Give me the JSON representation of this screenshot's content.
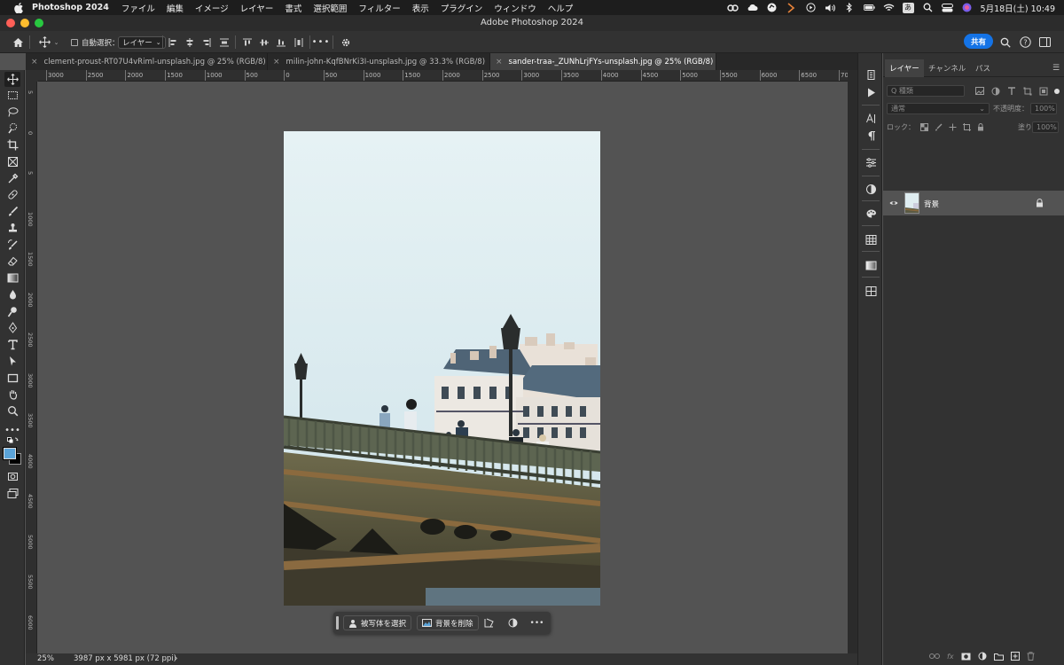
{
  "menubar": {
    "app_name": "Photoshop 2024",
    "items": [
      "ファイル",
      "編集",
      "イメージ",
      "レイヤー",
      "書式",
      "選択範囲",
      "フィルター",
      "表示",
      "プラグイン",
      "ウィンドウ",
      "ヘルプ"
    ],
    "ime_label": "あ",
    "clock": "5月18日(土)  10:49"
  },
  "window": {
    "title": "Adobe Photoshop 2024"
  },
  "options_bar": {
    "auto_select_label": "自動選択：",
    "auto_select_target": "レイヤー",
    "share_label": "共有"
  },
  "tabs": [
    {
      "label": "clement-proust-RT07U4vRiml-unsplash.jpg @ 25% (RGB/8)",
      "active": false
    },
    {
      "label": "milin-john-KqfBNrKi3I-unsplash.jpg @ 33.3% (RGB/8)",
      "active": false
    },
    {
      "label": "sander-traa-_ZUNhLrjFYs-unsplash.jpg @ 25% (RGB/8)",
      "active": true
    }
  ],
  "ruler": {
    "h_labels": [
      "3000",
      "2500",
      "2000",
      "1500",
      "1000",
      "500",
      "0",
      "500",
      "1000",
      "1500",
      "2000",
      "2500",
      "3000",
      "3500",
      "4000",
      "4500",
      "5000",
      "5500",
      "6000",
      "6500",
      "70"
    ],
    "v_labels": [
      "5",
      "0",
      "5",
      "1000",
      "1500",
      "2000",
      "2500",
      "3000",
      "3500",
      "4000",
      "4500",
      "5000",
      "5500",
      "6000"
    ]
  },
  "context_bar": {
    "select_subject": "被写体を選択",
    "remove_background": "背景を削除",
    "more": "•••"
  },
  "status": {
    "zoom": "25%",
    "doc_info": "3987 px x 5981 px (72 ppi)",
    "arrow": "›"
  },
  "layers_panel": {
    "tabs": [
      "レイヤー",
      "チャンネル",
      "パス"
    ],
    "search_placeholder": "Q 種類",
    "blend_mode": "通常",
    "opacity_label": "不透明度：",
    "opacity_value": "100%",
    "lock_label": "ロック：",
    "fill_label": "塗り：",
    "fill_value": "100%",
    "layer_name": "背景"
  },
  "colors": {
    "accent": "#1473e6",
    "foreground_swatch": "#5ba4d9",
    "background_swatch": "#000000"
  }
}
